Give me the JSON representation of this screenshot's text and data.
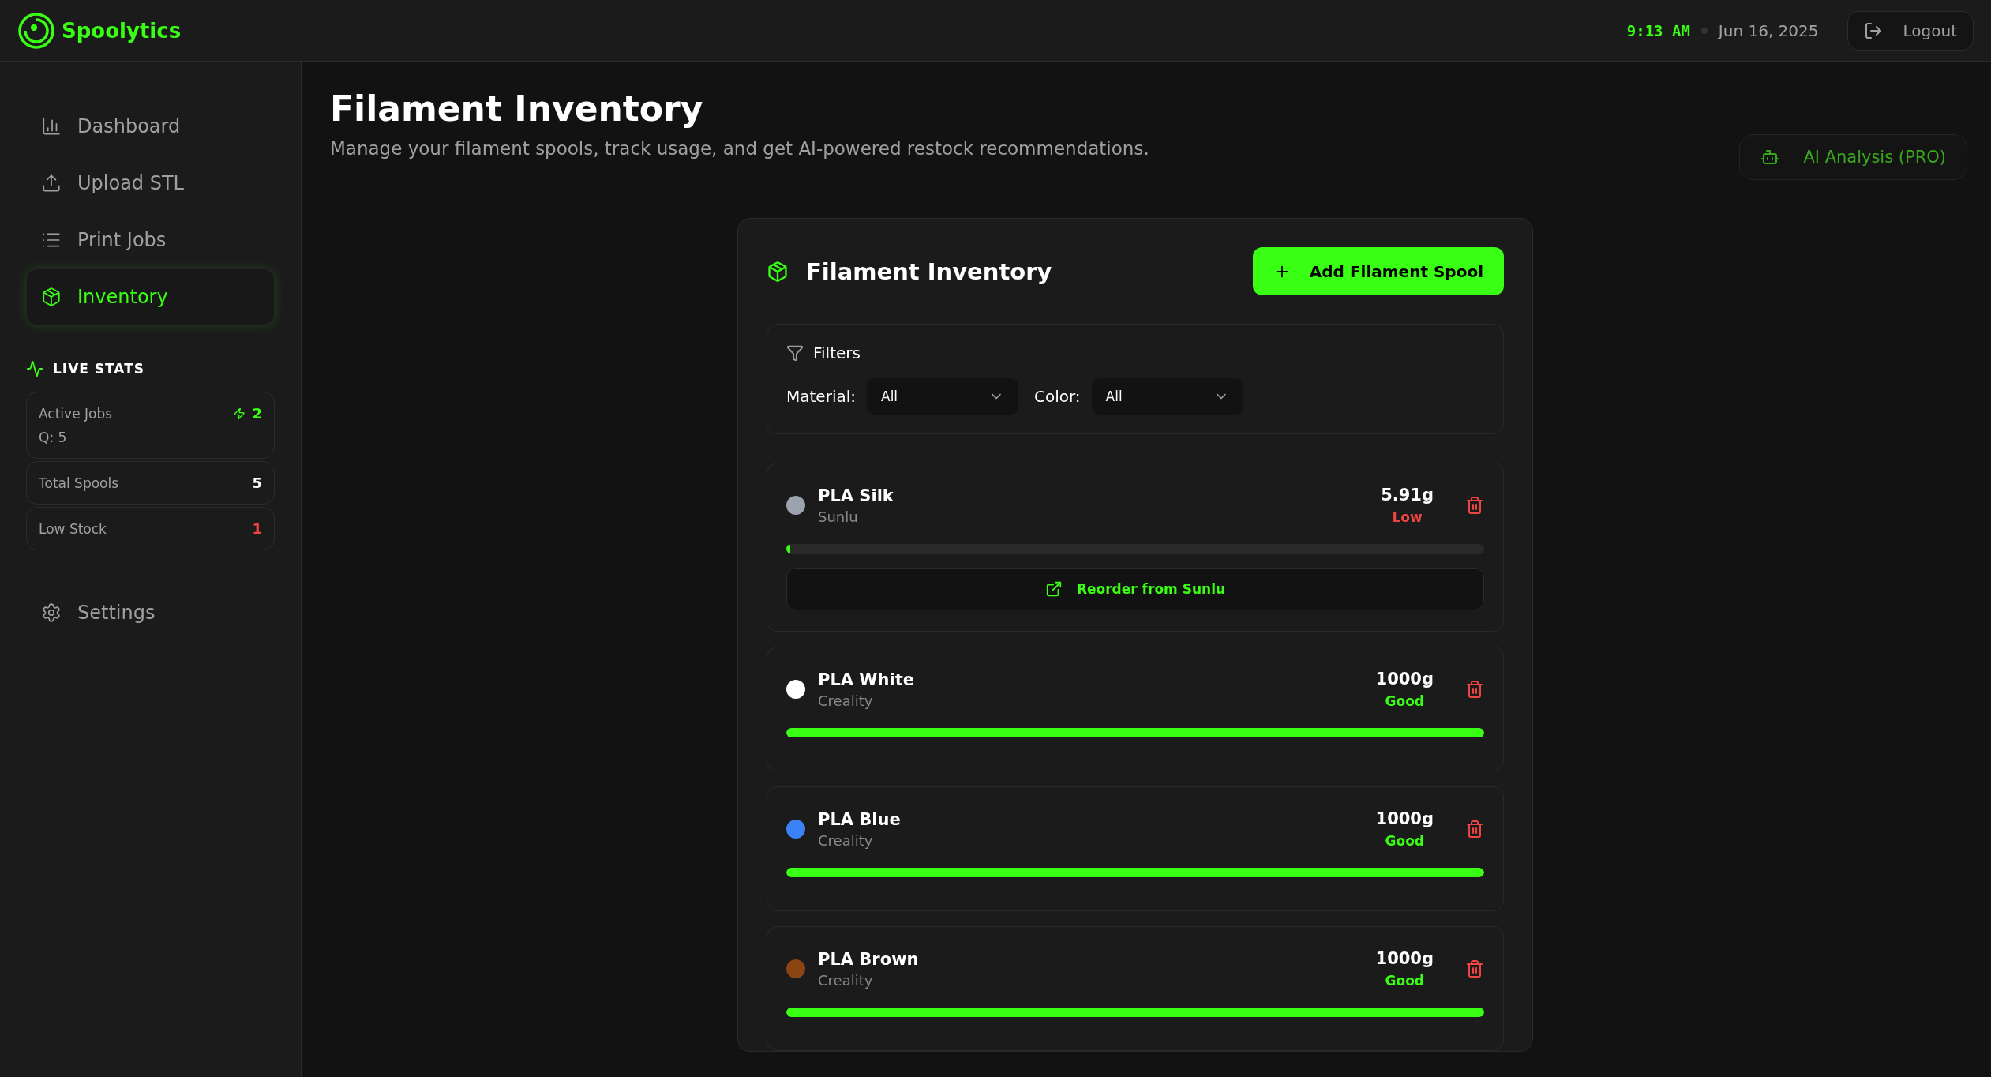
{
  "app": {
    "name": "Spoolytics"
  },
  "header": {
    "time": "9:13 AM",
    "date": "Jun 16, 2025",
    "logout": "Logout"
  },
  "sidebar": {
    "items": [
      {
        "label": "Dashboard",
        "selected": false
      },
      {
        "label": "Upload STL",
        "selected": false
      },
      {
        "label": "Print Jobs",
        "selected": false
      },
      {
        "label": "Inventory",
        "selected": true
      }
    ],
    "live_stats": {
      "title": "LIVE STATS",
      "stats": [
        {
          "label": "Active Jobs",
          "value": "2",
          "kind": "active",
          "sub": "Q: 5"
        },
        {
          "label": "Total Spools",
          "value": "5",
          "kind": "plain"
        },
        {
          "label": "Low Stock",
          "value": "1",
          "kind": "danger"
        }
      ]
    },
    "settings": "Settings"
  },
  "page": {
    "title": "Filament Inventory",
    "subtitle": "Manage your filament spools, track usage, and get AI-powered restock recommendations.",
    "ai_button": "AI Analysis (PRO)"
  },
  "inventory": {
    "title": "Filament Inventory",
    "add_button": "Add Filament Spool",
    "filters": {
      "title": "Filters",
      "fields": [
        {
          "label": "Material:",
          "value": "All"
        },
        {
          "label": "Color:",
          "value": "All"
        }
      ]
    },
    "spools": [
      {
        "name": "PLA Silk",
        "brand": "Sunlu",
        "color": "#9ca3af",
        "weight": "5.91g",
        "status": "Low",
        "kind": "low",
        "level": 0.006,
        "reorder": "Reorder from Sunlu"
      },
      {
        "name": "PLA White",
        "brand": "Creality",
        "color": "#ffffff",
        "weight": "1000g",
        "status": "Good",
        "kind": "good",
        "level": 1
      },
      {
        "name": "PLA Blue",
        "brand": "Creality",
        "color": "#3b82f6",
        "weight": "1000g",
        "status": "Good",
        "kind": "good",
        "level": 1
      },
      {
        "name": "PLA Brown",
        "brand": "Creality",
        "color": "#8b4513",
        "weight": "1000g",
        "status": "Good",
        "kind": "good",
        "level": 1
      }
    ]
  }
}
